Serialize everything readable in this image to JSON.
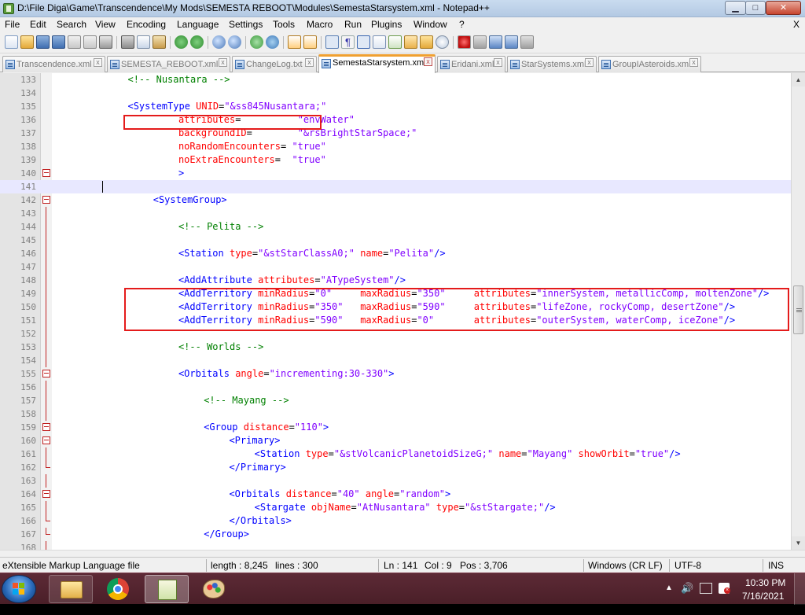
{
  "window": {
    "title": "D:\\File Diga\\Game\\Transcendence\\My Mods\\SEMESTA REBOOT\\Modules\\SemestaStarsystem.xml - Notepad++",
    "minimize_glyph": "▁",
    "maximize_glyph": "□",
    "close_glyph": "✕"
  },
  "menu": {
    "items": [
      "File",
      "Edit",
      "Search",
      "View",
      "Encoding",
      "Language",
      "Settings",
      "Tools",
      "Macro",
      "Run",
      "Plugins",
      "Window",
      "?"
    ],
    "close_glyph": "X"
  },
  "toolbar": {
    "buttons": [
      "new-file-icon",
      "open-file-icon",
      "save-icon",
      "save-all-icon",
      "close-icon",
      "close-all-icon",
      "print-icon",
      "cut-icon",
      "copy-icon",
      "paste-icon",
      "undo-icon",
      "redo-icon",
      "find-icon",
      "replace-icon",
      "zoom-in-icon",
      "zoom-out-icon",
      "sync-vertical-icon",
      "sync-horizontal-icon",
      "word-wrap-icon",
      "show-all-chars-icon",
      "indent-guide-icon",
      "user-language-icon",
      "doc-map-icon",
      "function-list-icon",
      "folder-workspace-icon",
      "monitoring-icon",
      "record-macro-icon",
      "stop-macro-icon",
      "play-macro-icon",
      "run-macro-multiple-icon",
      "save-macro-icon"
    ]
  },
  "tabs": [
    {
      "label": "Transcendence.xml",
      "active": false
    },
    {
      "label": "SEMESTA_REBOOT.xml",
      "active": false
    },
    {
      "label": "ChangeLog.txt",
      "active": false
    },
    {
      "label": "SemestaStarsystem.xml",
      "active": true
    },
    {
      "label": "Eridani.xml",
      "active": false
    },
    {
      "label": "StarSystems.xml",
      "active": false
    },
    {
      "label": "GroupIAsteroids.xml",
      "active": false
    }
  ],
  "editor": {
    "current_line": 141,
    "lines": [
      {
        "n": "133",
        "tokens": [
          {
            "t": "cm",
            "v": "<!-- Nusantara -->"
          }
        ],
        "indent": 8
      },
      {
        "n": "134",
        "tokens": [],
        "indent": 0
      },
      {
        "n": "135",
        "tokens": [
          {
            "t": "tg",
            "v": "<SystemType "
          },
          {
            "t": "at",
            "v": "UNID"
          },
          {
            "t": "eq",
            "v": "="
          },
          {
            "t": "vl",
            "v": "\"&ss845Nusantara;\""
          }
        ],
        "indent": 8
      },
      {
        "n": "136",
        "tokens": [
          {
            "t": "at",
            "v": "attributes"
          },
          {
            "t": "eq",
            "v": "=          "
          },
          {
            "t": "vl",
            "v": "\"envWater\""
          }
        ],
        "indent": 16
      },
      {
        "n": "137",
        "tokens": [
          {
            "t": "at",
            "v": "backgroundID"
          },
          {
            "t": "eq",
            "v": "=        "
          },
          {
            "t": "vl",
            "v": "\"&rsBrightStarSpace;\""
          }
        ],
        "indent": 16
      },
      {
        "n": "138",
        "tokens": [
          {
            "t": "at",
            "v": "noRandomEncounters"
          },
          {
            "t": "eq",
            "v": "= "
          },
          {
            "t": "vl",
            "v": "\"true\""
          }
        ],
        "indent": 16
      },
      {
        "n": "139",
        "tokens": [
          {
            "t": "at",
            "v": "noExtraEncounters"
          },
          {
            "t": "eq",
            "v": "=  "
          },
          {
            "t": "vl",
            "v": "\"true\""
          }
        ],
        "indent": 16
      },
      {
        "n": "140",
        "tokens": [
          {
            "t": "tg",
            "v": ">"
          }
        ],
        "indent": 16
      },
      {
        "n": "141",
        "tokens": [],
        "indent": 0
      },
      {
        "n": "142",
        "tokens": [
          {
            "t": "tg",
            "v": "<SystemGroup>"
          }
        ],
        "indent": 12
      },
      {
        "n": "143",
        "tokens": [],
        "indent": 0
      },
      {
        "n": "144",
        "tokens": [
          {
            "t": "cm",
            "v": "<!-- Pelita -->"
          }
        ],
        "indent": 16
      },
      {
        "n": "145",
        "tokens": [],
        "indent": 0
      },
      {
        "n": "146",
        "tokens": [
          {
            "t": "tg",
            "v": "<Station "
          },
          {
            "t": "at",
            "v": "type"
          },
          {
            "t": "eq",
            "v": "="
          },
          {
            "t": "vl",
            "v": "\"&stStarClassA0;\""
          },
          {
            "t": "eq",
            "v": " "
          },
          {
            "t": "at",
            "v": "name"
          },
          {
            "t": "eq",
            "v": "="
          },
          {
            "t": "vl",
            "v": "\"Pelita\""
          },
          {
            "t": "tg",
            "v": "/>"
          }
        ],
        "indent": 16
      },
      {
        "n": "147",
        "tokens": [],
        "indent": 0
      },
      {
        "n": "148",
        "tokens": [
          {
            "t": "tg",
            "v": "<AddAttribute "
          },
          {
            "t": "at",
            "v": "attributes"
          },
          {
            "t": "eq",
            "v": "="
          },
          {
            "t": "vl",
            "v": "\"ATypeSystem\""
          },
          {
            "t": "tg",
            "v": "/>"
          }
        ],
        "indent": 16
      },
      {
        "n": "149",
        "tokens": [
          {
            "t": "tg",
            "v": "<AddTerritory "
          },
          {
            "t": "at",
            "v": "minRadius"
          },
          {
            "t": "eq",
            "v": "="
          },
          {
            "t": "vl",
            "v": "\"0\""
          },
          {
            "t": "eq",
            "v": "     "
          },
          {
            "t": "at",
            "v": "maxRadius"
          },
          {
            "t": "eq",
            "v": "="
          },
          {
            "t": "vl",
            "v": "\"350\""
          },
          {
            "t": "eq",
            "v": "     "
          },
          {
            "t": "at",
            "v": "attributes"
          },
          {
            "t": "eq",
            "v": "="
          },
          {
            "t": "vl",
            "v": "\"innerSystem, metallicComp, moltenZone\""
          },
          {
            "t": "tg",
            "v": "/>"
          }
        ],
        "indent": 16
      },
      {
        "n": "150",
        "tokens": [
          {
            "t": "tg",
            "v": "<AddTerritory "
          },
          {
            "t": "at",
            "v": "minRadius"
          },
          {
            "t": "eq",
            "v": "="
          },
          {
            "t": "vl",
            "v": "\"350\""
          },
          {
            "t": "eq",
            "v": "   "
          },
          {
            "t": "at",
            "v": "maxRadius"
          },
          {
            "t": "eq",
            "v": "="
          },
          {
            "t": "vl",
            "v": "\"590\""
          },
          {
            "t": "eq",
            "v": "     "
          },
          {
            "t": "at",
            "v": "attributes"
          },
          {
            "t": "eq",
            "v": "="
          },
          {
            "t": "vl",
            "v": "\"lifeZone, rockyComp, desertZone\""
          },
          {
            "t": "tg",
            "v": "/>"
          }
        ],
        "indent": 16
      },
      {
        "n": "151",
        "tokens": [
          {
            "t": "tg",
            "v": "<AddTerritory "
          },
          {
            "t": "at",
            "v": "minRadius"
          },
          {
            "t": "eq",
            "v": "="
          },
          {
            "t": "vl",
            "v": "\"590\""
          },
          {
            "t": "eq",
            "v": "   "
          },
          {
            "t": "at",
            "v": "maxRadius"
          },
          {
            "t": "eq",
            "v": "="
          },
          {
            "t": "vl",
            "v": "\"0\""
          },
          {
            "t": "eq",
            "v": "       "
          },
          {
            "t": "at",
            "v": "attributes"
          },
          {
            "t": "eq",
            "v": "="
          },
          {
            "t": "vl",
            "v": "\"outerSystem, waterComp, iceZone\""
          },
          {
            "t": "tg",
            "v": "/>"
          }
        ],
        "indent": 16
      },
      {
        "n": "152",
        "tokens": [],
        "indent": 0
      },
      {
        "n": "153",
        "tokens": [
          {
            "t": "cm",
            "v": "<!-- Worlds -->"
          }
        ],
        "indent": 16
      },
      {
        "n": "154",
        "tokens": [],
        "indent": 0
      },
      {
        "n": "155",
        "tokens": [
          {
            "t": "tg",
            "v": "<Orbitals "
          },
          {
            "t": "at",
            "v": "angle"
          },
          {
            "t": "eq",
            "v": "="
          },
          {
            "t": "vl",
            "v": "\"incrementing:30-330\""
          },
          {
            "t": "tg",
            "v": ">"
          }
        ],
        "indent": 16
      },
      {
        "n": "156",
        "tokens": [],
        "indent": 0
      },
      {
        "n": "157",
        "tokens": [
          {
            "t": "cm",
            "v": "<!-- Mayang -->"
          }
        ],
        "indent": 20
      },
      {
        "n": "158",
        "tokens": [],
        "indent": 0
      },
      {
        "n": "159",
        "tokens": [
          {
            "t": "tg",
            "v": "<Group "
          },
          {
            "t": "at",
            "v": "distance"
          },
          {
            "t": "eq",
            "v": "="
          },
          {
            "t": "vl",
            "v": "\"110\""
          },
          {
            "t": "tg",
            "v": ">"
          }
        ],
        "indent": 20
      },
      {
        "n": "160",
        "tokens": [
          {
            "t": "tg",
            "v": "<Primary>"
          }
        ],
        "indent": 24
      },
      {
        "n": "161",
        "tokens": [
          {
            "t": "tg",
            "v": "<Station "
          },
          {
            "t": "at",
            "v": "type"
          },
          {
            "t": "eq",
            "v": "="
          },
          {
            "t": "vl",
            "v": "\"&stVolcanicPlanetoidSizeG;\""
          },
          {
            "t": "eq",
            "v": " "
          },
          {
            "t": "at",
            "v": "name"
          },
          {
            "t": "eq",
            "v": "="
          },
          {
            "t": "vl",
            "v": "\"Mayang\""
          },
          {
            "t": "eq",
            "v": " "
          },
          {
            "t": "at",
            "v": "showOrbit"
          },
          {
            "t": "eq",
            "v": "="
          },
          {
            "t": "vl",
            "v": "\"true\""
          },
          {
            "t": "tg",
            "v": "/>"
          }
        ],
        "indent": 28
      },
      {
        "n": "162",
        "tokens": [
          {
            "t": "tg",
            "v": "</Primary>"
          }
        ],
        "indent": 24
      },
      {
        "n": "163",
        "tokens": [],
        "indent": 0
      },
      {
        "n": "164",
        "tokens": [
          {
            "t": "tg",
            "v": "<Orbitals "
          },
          {
            "t": "at",
            "v": "distance"
          },
          {
            "t": "eq",
            "v": "="
          },
          {
            "t": "vl",
            "v": "\"40\""
          },
          {
            "t": "eq",
            "v": " "
          },
          {
            "t": "at",
            "v": "angle"
          },
          {
            "t": "eq",
            "v": "="
          },
          {
            "t": "vl",
            "v": "\"random\""
          },
          {
            "t": "tg",
            "v": ">"
          }
        ],
        "indent": 24
      },
      {
        "n": "165",
        "tokens": [
          {
            "t": "tg",
            "v": "<Stargate "
          },
          {
            "t": "at",
            "v": "objName"
          },
          {
            "t": "eq",
            "v": "="
          },
          {
            "t": "vl",
            "v": "\"AtNusantara\""
          },
          {
            "t": "eq",
            "v": " "
          },
          {
            "t": "at",
            "v": "type"
          },
          {
            "t": "eq",
            "v": "="
          },
          {
            "t": "vl",
            "v": "\"&stStargate;\""
          },
          {
            "t": "tg",
            "v": "/>"
          }
        ],
        "indent": 28
      },
      {
        "n": "166",
        "tokens": [
          {
            "t": "tg",
            "v": "</Orbitals>"
          }
        ],
        "indent": 24
      },
      {
        "n": "167",
        "tokens": [
          {
            "t": "tg",
            "v": "</Group>"
          }
        ],
        "indent": 20
      },
      {
        "n": "168",
        "tokens": [],
        "indent": 0
      }
    ]
  },
  "status": {
    "file_type": "eXtensible Markup Language file",
    "length": "length : 8,245",
    "lines": "lines : 300",
    "ln": "Ln : 141",
    "col": "Col : 9",
    "pos": "Pos : 3,706",
    "eol": "Windows (CR LF)",
    "encoding": "UTF-8",
    "mode": "INS"
  },
  "taskbar": {
    "time": "10:30 PM",
    "date": "7/16/2021",
    "apps": [
      "start-button",
      "file-explorer-icon",
      "chrome-icon",
      "notepad-plus-plus-icon",
      "paint-icon"
    ]
  },
  "colors": {
    "comment": "#008000",
    "tag": "#0000ff",
    "attribute": "#ff0000",
    "value": "#8000ff",
    "highlight_box": "#e41b1b",
    "current_line": "#e8e8ff"
  }
}
